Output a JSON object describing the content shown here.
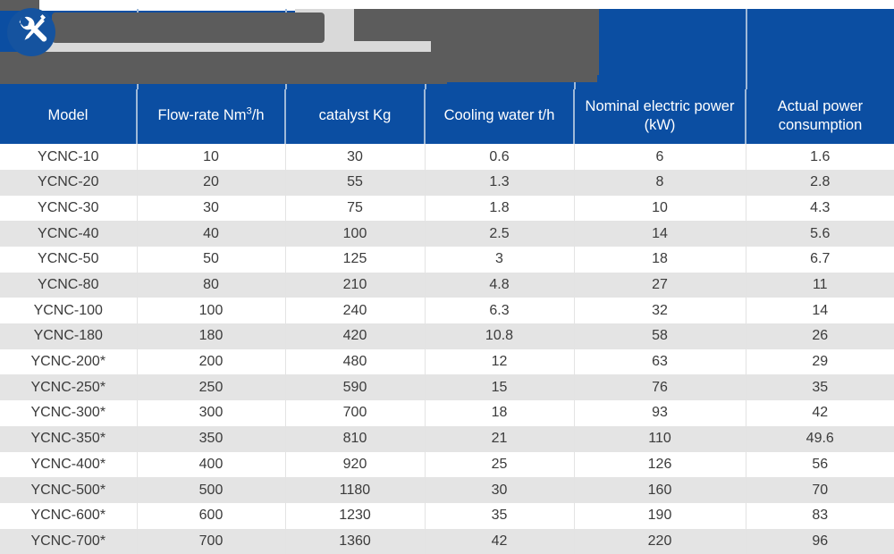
{
  "masthead": {
    "icon": "tools-wrench-screwdriver-icon",
    "note": "redacted-logo-banner",
    "colors": {
      "brand_blue": "#0b4ea2",
      "icon_blue": "#15539f",
      "redact_dark": "#5c5c5c",
      "redact_light": "#d9d9d9"
    }
  },
  "table": {
    "columns": [
      {
        "label": "Model",
        "sup": ""
      },
      {
        "label": "Flow-rate Nm",
        "sup": "3",
        "label_tail": "/h"
      },
      {
        "label": "catalyst Kg",
        "sup": ""
      },
      {
        "label": "Cooling water t/h",
        "sup": ""
      },
      {
        "label": "Nominal electric power (kW)",
        "sup": ""
      },
      {
        "label": "Actual power consumption",
        "sup": ""
      }
    ],
    "column_labels": [
      "Model",
      "Flow-rate Nm3/h",
      "catalyst Kg",
      "Cooling water t/h",
      "Nominal electric power (kW)",
      "Actual power consumption"
    ],
    "rows": [
      {
        "model": "YCNC-10",
        "flow_rate": "10",
        "catalyst": "30",
        "cooling_water": "0.6",
        "nominal_power": "6",
        "actual_power": "1.6"
      },
      {
        "model": "YCNC-20",
        "flow_rate": "20",
        "catalyst": "55",
        "cooling_water": "1.3",
        "nominal_power": "8",
        "actual_power": "2.8"
      },
      {
        "model": "YCNC-30",
        "flow_rate": "30",
        "catalyst": "75",
        "cooling_water": "1.8",
        "nominal_power": "10",
        "actual_power": "4.3"
      },
      {
        "model": "YCNC-40",
        "flow_rate": "40",
        "catalyst": "100",
        "cooling_water": "2.5",
        "nominal_power": "14",
        "actual_power": "5.6"
      },
      {
        "model": "YCNC-50",
        "flow_rate": "50",
        "catalyst": "125",
        "cooling_water": "3",
        "nominal_power": "18",
        "actual_power": "6.7"
      },
      {
        "model": "YCNC-80",
        "flow_rate": "80",
        "catalyst": "210",
        "cooling_water": "4.8",
        "nominal_power": "27",
        "actual_power": "11"
      },
      {
        "model": "YCNC-100",
        "flow_rate": "100",
        "catalyst": "240",
        "cooling_water": "6.3",
        "nominal_power": "32",
        "actual_power": "14"
      },
      {
        "model": "YCNC-180",
        "flow_rate": "180",
        "catalyst": "420",
        "cooling_water": "10.8",
        "nominal_power": "58",
        "actual_power": "26"
      },
      {
        "model": "YCNC-200*",
        "flow_rate": "200",
        "catalyst": "480",
        "cooling_water": "12",
        "nominal_power": "63",
        "actual_power": "29"
      },
      {
        "model": "YCNC-250*",
        "flow_rate": "250",
        "catalyst": "590",
        "cooling_water": "15",
        "nominal_power": "76",
        "actual_power": "35"
      },
      {
        "model": "YCNC-300*",
        "flow_rate": "300",
        "catalyst": "700",
        "cooling_water": "18",
        "nominal_power": "93",
        "actual_power": "42"
      },
      {
        "model": "YCNC-350*",
        "flow_rate": "350",
        "catalyst": "810",
        "cooling_water": "21",
        "nominal_power": "110",
        "actual_power": "49.6"
      },
      {
        "model": "YCNC-400*",
        "flow_rate": "400",
        "catalyst": "920",
        "cooling_water": "25",
        "nominal_power": "126",
        "actual_power": "56"
      },
      {
        "model": "YCNC-500*",
        "flow_rate": "500",
        "catalyst": "1180",
        "cooling_water": "30",
        "nominal_power": "160",
        "actual_power": "70"
      },
      {
        "model": "YCNC-600*",
        "flow_rate": "600",
        "catalyst": "1230",
        "cooling_water": "35",
        "nominal_power": "190",
        "actual_power": "83"
      },
      {
        "model": "YCNC-700*",
        "flow_rate": "700",
        "catalyst": "1360",
        "cooling_water": "42",
        "nominal_power": "220",
        "actual_power": "96"
      }
    ]
  }
}
